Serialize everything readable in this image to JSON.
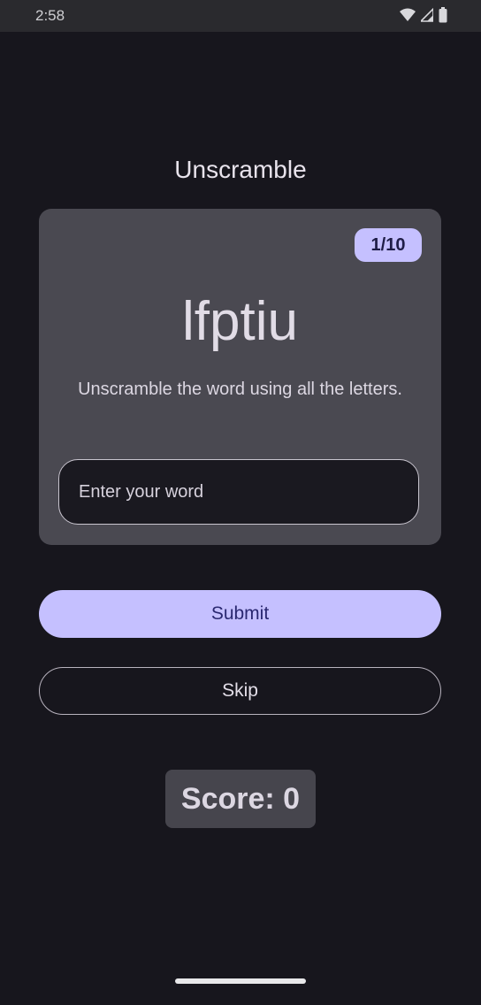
{
  "status_bar": {
    "time": "2:58",
    "icons": [
      "wifi-icon",
      "signal-icon",
      "battery-icon"
    ]
  },
  "app": {
    "title": "Unscramble"
  },
  "card": {
    "progress": "1/10",
    "scrambled_word": "lfptiu",
    "instructions": "Unscramble the word using all the letters.",
    "input": {
      "value": "",
      "placeholder": "Enter your word"
    }
  },
  "actions": {
    "submit_label": "Submit",
    "skip_label": "Skip"
  },
  "score": {
    "text": "Score: 0"
  },
  "colors": {
    "background": "#17161d",
    "card": "#4a4951",
    "accent": "#c5c0ff",
    "accent_text": "#2a2870"
  }
}
